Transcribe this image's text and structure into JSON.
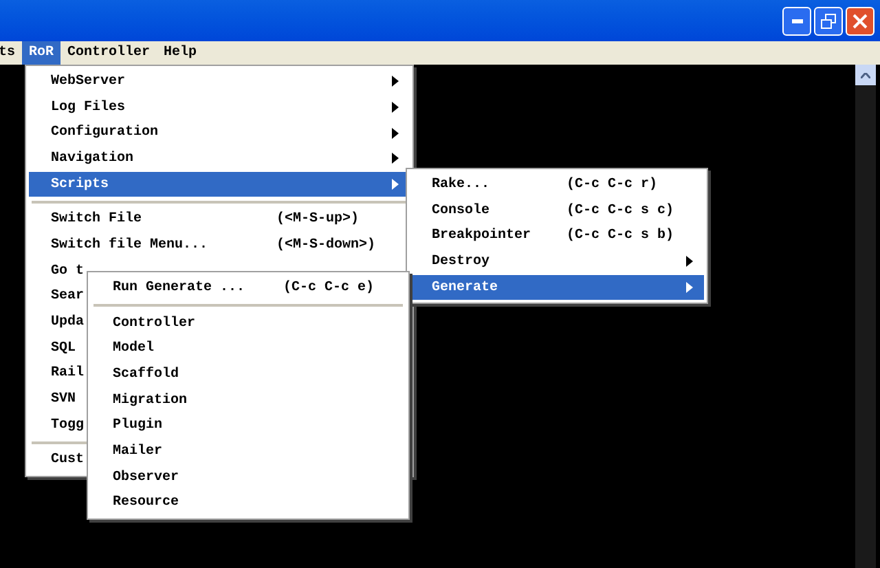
{
  "menubar": [
    {
      "label": "ts",
      "selected": false
    },
    {
      "label": "RoR",
      "selected": true
    },
    {
      "label": "Controller",
      "selected": false
    },
    {
      "label": "Help",
      "selected": false
    }
  ],
  "ror_menu": [
    {
      "kind": "submenu",
      "label": "WebServer",
      "selected": false
    },
    {
      "kind": "submenu",
      "label": "Log Files",
      "selected": false
    },
    {
      "kind": "submenu",
      "label": "Configuration",
      "selected": false
    },
    {
      "kind": "submenu",
      "label": "Navigation",
      "selected": false
    },
    {
      "kind": "submenu",
      "label": "Scripts",
      "selected": true
    },
    {
      "kind": "separator"
    },
    {
      "kind": "command",
      "label": "Switch File",
      "shortcut": "(<M-S-up>)",
      "selected": false
    },
    {
      "kind": "command",
      "label": "Switch file Menu...",
      "shortcut": "(<M-S-down>)",
      "selected": false
    },
    {
      "kind": "command",
      "label": "Go t",
      "selected": false
    },
    {
      "kind": "command",
      "label": "Sear",
      "selected": false
    },
    {
      "kind": "command",
      "label": "Upda",
      "selected": false
    },
    {
      "kind": "command",
      "label": "SQL",
      "selected": false
    },
    {
      "kind": "command",
      "label": "Rail",
      "selected": false
    },
    {
      "kind": "command",
      "label": "SVN",
      "selected": false
    },
    {
      "kind": "command",
      "label": "Togg",
      "selected": false
    },
    {
      "kind": "separator"
    },
    {
      "kind": "command",
      "label": "Cust",
      "selected": false
    }
  ],
  "scripts_menu": [
    {
      "kind": "command",
      "label": "Rake...",
      "shortcut": "(C-c C-c r)",
      "selected": false
    },
    {
      "kind": "command",
      "label": "Console",
      "shortcut": "(C-c C-c s c)",
      "selected": false
    },
    {
      "kind": "command",
      "label": "Breakpointer",
      "shortcut": "(C-c C-c s b)",
      "selected": false
    },
    {
      "kind": "submenu",
      "label": "Destroy",
      "selected": false
    },
    {
      "kind": "submenu",
      "label": "Generate",
      "selected": true
    }
  ],
  "generate_menu": [
    {
      "kind": "command",
      "label": "Run Generate ...",
      "shortcut": "(C-c C-c e)",
      "selected": false
    },
    {
      "kind": "separator"
    },
    {
      "kind": "command",
      "label": "Controller",
      "selected": false
    },
    {
      "kind": "command",
      "label": "Model",
      "selected": false
    },
    {
      "kind": "command",
      "label": "Scaffold",
      "selected": false
    },
    {
      "kind": "command",
      "label": "Migration",
      "selected": false
    },
    {
      "kind": "command",
      "label": "Plugin",
      "selected": false
    },
    {
      "kind": "command",
      "label": "Mailer",
      "selected": false
    },
    {
      "kind": "command",
      "label": "Observer",
      "selected": false
    },
    {
      "kind": "command",
      "label": "Resource",
      "selected": false
    }
  ]
}
